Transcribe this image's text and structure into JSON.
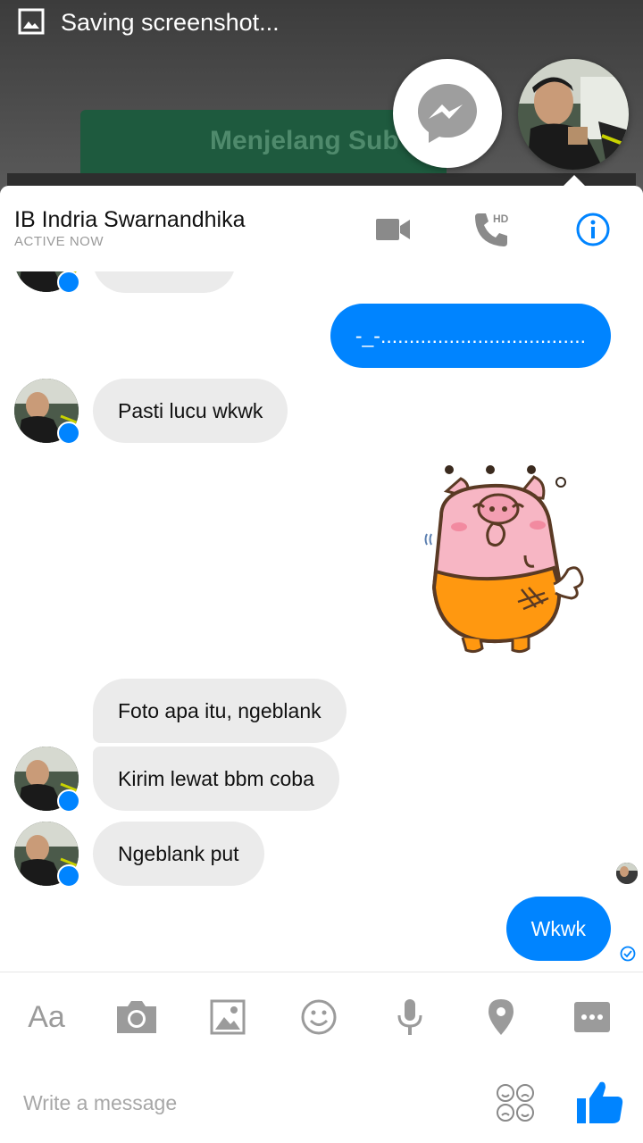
{
  "status_bar": {
    "notification": "Saving screenshot...",
    "icon": "image-icon"
  },
  "background_app": {
    "card_title": "Menjelang Sub"
  },
  "chat_heads": {
    "messenger_icon": "messenger-icon",
    "avatar": "contact-avatar"
  },
  "header": {
    "contact_name": "IB Indria Swarnandhika",
    "presence": "ACTIVE NOW",
    "video_icon": "video-call-icon",
    "call_badge": "HD",
    "info_icon": "info-icon",
    "accent_color": "#0084ff"
  },
  "messages": [
    {
      "from": "them",
      "text": ""
    },
    {
      "from": "me",
      "text": "-_-...................................."
    },
    {
      "from": "them",
      "text": "Pasti lucu wkwk"
    },
    {
      "from": "me",
      "type": "sticker",
      "sticker": "pig-sticker"
    },
    {
      "from": "them",
      "text": "Foto apa itu, ngeblank"
    },
    {
      "from": "them",
      "text": "Kirim lewat bbm coba"
    },
    {
      "from": "them",
      "text": "Ngeblank put"
    },
    {
      "from": "me",
      "text": "Wkwk",
      "status": "delivered-check-icon"
    }
  ],
  "toolbar": {
    "text_label": "Aa",
    "items": [
      "text-icon",
      "camera-icon",
      "gallery-icon",
      "emoji-icon",
      "microphone-icon",
      "location-icon",
      "more-icon"
    ]
  },
  "composer": {
    "placeholder": "Write a message",
    "stickers_icon": "stickers-icon",
    "like_icon": "like-icon"
  }
}
